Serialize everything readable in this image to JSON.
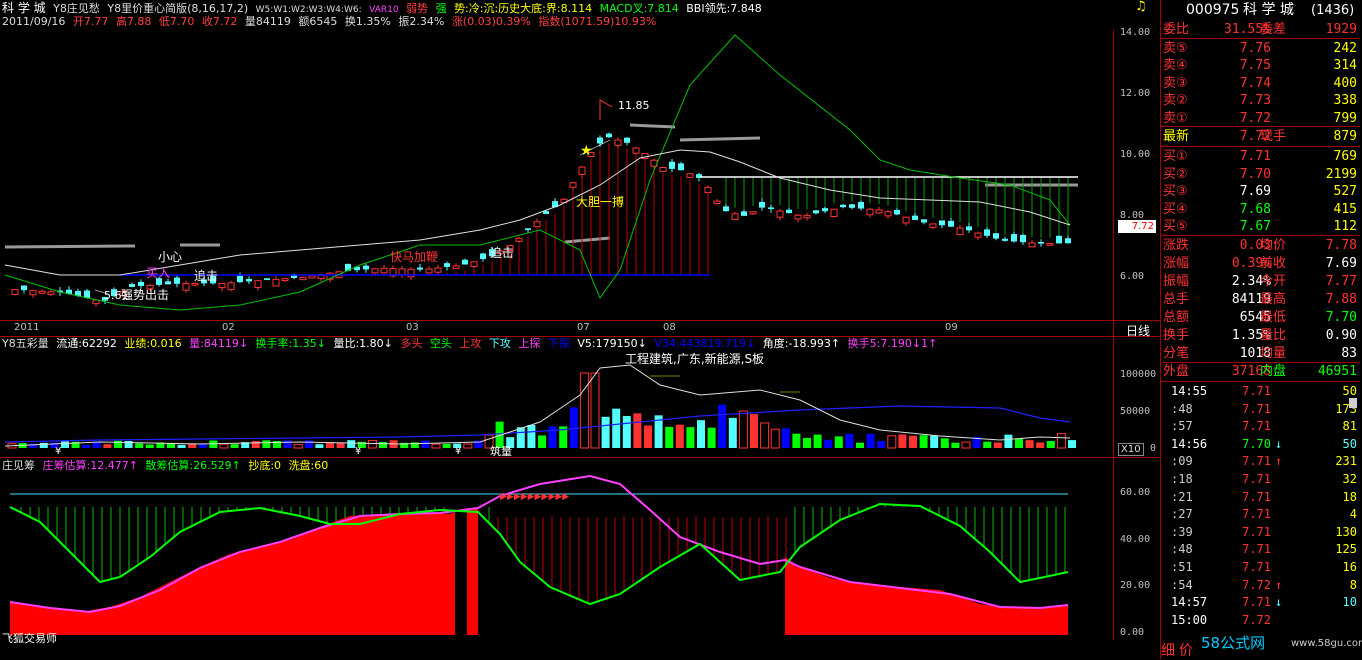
{
  "header": {
    "title": "科 学 城",
    "indicator1": "Y8庄见愁",
    "indicator2": "Y8里价重心简版(8,16,17,2)",
    "wlist": "W5:W1:W2:W3:W4:W6:",
    "var10": "VAR10",
    "stock_word": "弱势",
    "strong": "强",
    "trend": "势:冷:沉:历史大底:界:8.114",
    "macd": "MACD叉:7.814",
    "bbi": "BBI领先:7.848",
    "date": "2011/09/16",
    "open": "开7.77",
    "high": "高7.88",
    "low": "低7.70",
    "close": "收7.72",
    "vol": "量84119",
    "amt": "额6545",
    "turnover": "换1.35%",
    "amp": "振2.34%",
    "chg": "涨(0.03)0.39%",
    "index": "指数(1071.59)10.93%"
  },
  "main_chart": {
    "yticks": [
      "14.00",
      "12.00",
      "10.00",
      "8.00",
      "6.00"
    ],
    "current_price": "7.72",
    "peak_label": "11.85",
    "low_label": "5.61",
    "annotations": {
      "a1": "小心",
      "a2": "买入",
      "a3": "追击",
      "a4": "强势出击",
      "a5": "快马加鞭",
      "a6": "追击",
      "a7": "大胆一搏"
    },
    "xticks": [
      "2011",
      "02",
      "03",
      "07",
      "08",
      "09"
    ],
    "period": "日线"
  },
  "vol_panel": {
    "title": "Y8五彩量",
    "liutong": "流通:62292",
    "yeji": "业绩:0.016",
    "liang": "量:84119↓",
    "hsl": "换手率:1.35↓",
    "lb": "量比:1.80↓",
    "duotou": "多头",
    "kongtou": "空头",
    "shanggong": "上攻",
    "xiagong": "下攻",
    "shangtan": "上探",
    "xiatan": "下探",
    "v5": "V5:179150↓",
    "v34": "V34:443819.719↓",
    "jiaodu": "角度:-18.993↑",
    "huanshou5": "换手5:7.190↓1↑",
    "news": "工程建筑,广东,新能源,S板",
    "label_bottom": "筑量",
    "yticks": [
      "100000",
      "50000",
      "0"
    ],
    "x10": "X10"
  },
  "chip_panel": {
    "title": "庄见筹",
    "zhuang": "庄筹估算:12.477↑",
    "san": "散筹估算:26.529↑",
    "chaodi": "抄底:0",
    "xipan": "洗盘:60",
    "yticks": [
      "60.00",
      "40.00",
      "20.00",
      "0.00"
    ],
    "brand": "飞狐交易师"
  },
  "quote": {
    "code": "000975",
    "name": "科 学 城",
    "seq": "(1436)",
    "weibi_label": "委比",
    "weibi": "31.55%",
    "weicha_label": "委差",
    "weicha": "1929",
    "sells": [
      {
        "label": "卖⑤",
        "price": "7.76",
        "vol": "242"
      },
      {
        "label": "卖④",
        "price": "7.75",
        "vol": "314"
      },
      {
        "label": "卖③",
        "price": "7.74",
        "vol": "400"
      },
      {
        "label": "卖②",
        "price": "7.73",
        "vol": "338"
      },
      {
        "label": "卖①",
        "price": "7.72",
        "vol": "799"
      }
    ],
    "last_label": "最新",
    "last": "7.72",
    "xianshou_label": "现手",
    "xianshou": "879",
    "buys": [
      {
        "label": "买①",
        "price": "7.71",
        "vol": "769"
      },
      {
        "label": "买②",
        "price": "7.70",
        "vol": "2199"
      },
      {
        "label": "买③",
        "price": "7.69",
        "vol": "527"
      },
      {
        "label": "买④",
        "price": "7.68",
        "vol": "415"
      },
      {
        "label": "买⑤",
        "price": "7.67",
        "vol": "112"
      }
    ],
    "stats": [
      {
        "l1": "涨跌",
        "v1": "0.03",
        "l2": "均价",
        "v2": "7.78"
      },
      {
        "l1": "涨幅",
        "v1": "0.39%",
        "l2": "前收",
        "v2": "7.69"
      },
      {
        "l1": "振幅",
        "v1": "2.34%",
        "l2": "今开",
        "v2": "7.77"
      },
      {
        "l1": "总手",
        "v1": "84119",
        "l2": "最高",
        "v2": "7.88"
      },
      {
        "l1": "总额",
        "v1": "6545",
        "l2": "最低",
        "v2": "7.70"
      },
      {
        "l1": "换手",
        "v1": "1.35%",
        "l2": "量比",
        "v2": "0.90"
      },
      {
        "l1": "分笔",
        "v1": "1018",
        "l2": "均量",
        "v2": "83"
      }
    ],
    "waipan_label": "外盘",
    "waipan": "37168",
    "neipan_label": "内盘",
    "neipan": "46951",
    "ticks": [
      {
        "t": "14:55",
        "p": "7.71",
        "a": "",
        "q": "50"
      },
      {
        "t": ":48",
        "p": "7.71",
        "a": "",
        "q": "173"
      },
      {
        "t": ":57",
        "p": "7.71",
        "a": "",
        "q": "81"
      },
      {
        "t": "14:56",
        "p": "7.70",
        "a": "↓",
        "q": "50"
      },
      {
        "t": ":09",
        "p": "7.71",
        "a": "↑",
        "q": "231"
      },
      {
        "t": ":18",
        "p": "7.71",
        "a": "",
        "q": "32"
      },
      {
        "t": ":21",
        "p": "7.71",
        "a": "",
        "q": "18"
      },
      {
        "t": ":27",
        "p": "7.71",
        "a": "",
        "q": "4"
      },
      {
        "t": ":39",
        "p": "7.71",
        "a": "",
        "q": "130"
      },
      {
        "t": ":48",
        "p": "7.71",
        "a": "",
        "q": "125"
      },
      {
        "t": ":51",
        "p": "7.71",
        "a": "",
        "q": "16"
      },
      {
        "t": ":54",
        "p": "7.72",
        "a": "↑",
        "q": "8"
      },
      {
        "t": "14:57",
        "p": "7.71",
        "a": "↓",
        "q": "10"
      },
      {
        "t": "15:00",
        "p": "7.72",
        "a": "",
        "q": ""
      }
    ],
    "tab1": "细",
    "tab2": "价",
    "watermark": "58公式网",
    "watermark_url": "www.58gu.com"
  },
  "colors": {
    "up": "#ff3232",
    "down": "#54ffff",
    "green": "#00ff00",
    "gold": "#ffff00",
    "magenta": "#ff40ff",
    "blue": "#0000ff"
  }
}
